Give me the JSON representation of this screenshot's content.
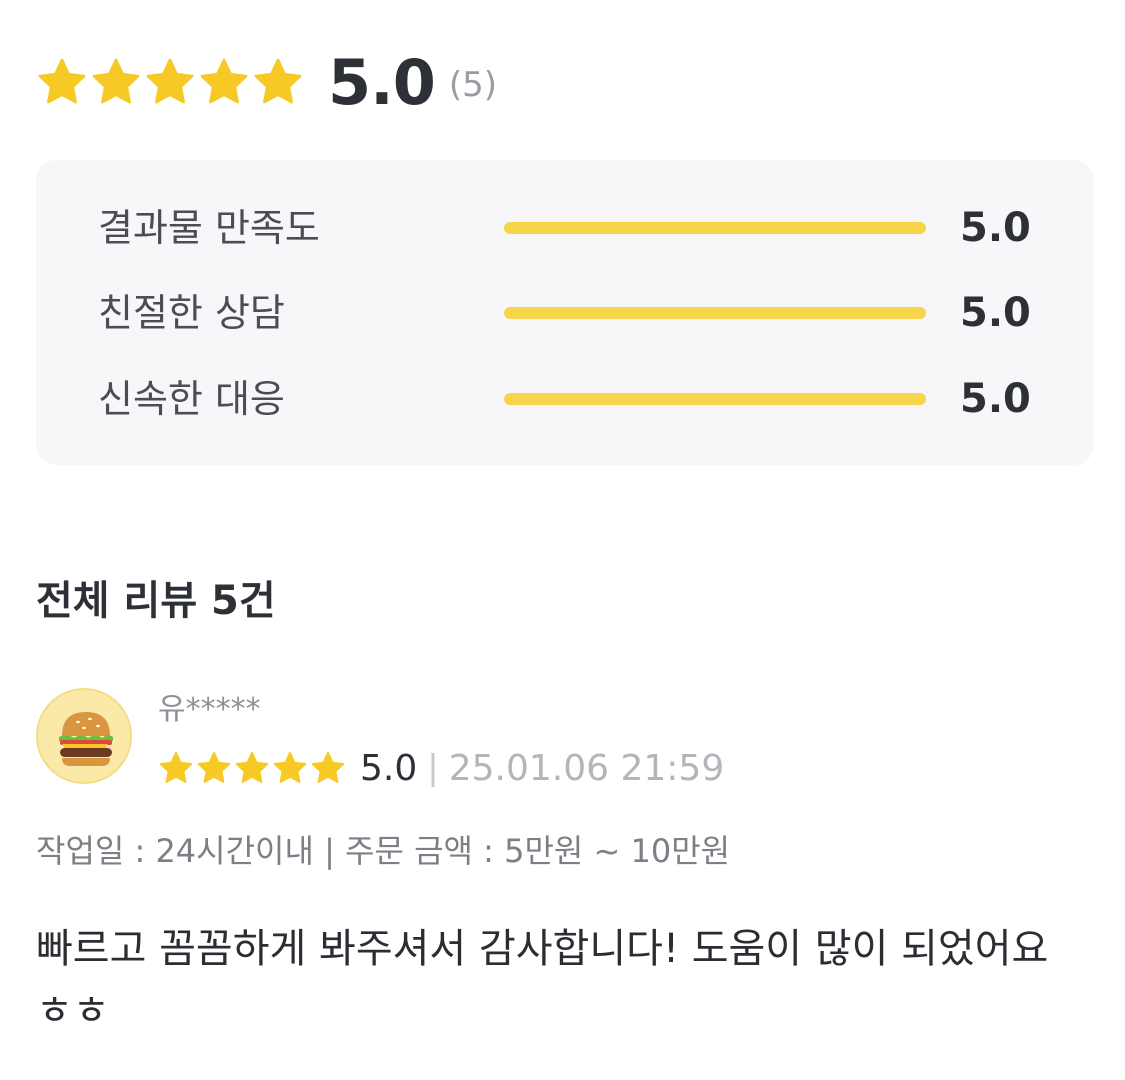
{
  "rating_summary": {
    "stars": 5,
    "score": "5.0",
    "count": "(5)"
  },
  "criteria": [
    {
      "label": "결과물 만족도",
      "score": "5.0",
      "fill": 1.0
    },
    {
      "label": "친절한 상담",
      "score": "5.0",
      "fill": 1.0
    },
    {
      "label": "신속한 대응",
      "score": "5.0",
      "fill": 1.0
    }
  ],
  "reviews_section": {
    "title": "전체 리뷰 5건"
  },
  "review": {
    "avatar_icon": "hamburger-icon",
    "reviewer": "유*****",
    "stars": 5,
    "score": "5.0",
    "separator": "|",
    "date": "25.01.06 21:59",
    "work_info": "작업일 : 24시간이내 | 주문 금액 : 5만원 ~ 10만원",
    "body": "빠르고 꼼꼼하게 봐주셔서 감사합니다! 도움이 많이 되었어요 ㅎㅎ"
  },
  "colors": {
    "star": "#f6c925",
    "bar_fill": "#f6d54a",
    "panel_bg": "#f7f7f9",
    "avatar_bg": "#fbe9a8"
  }
}
